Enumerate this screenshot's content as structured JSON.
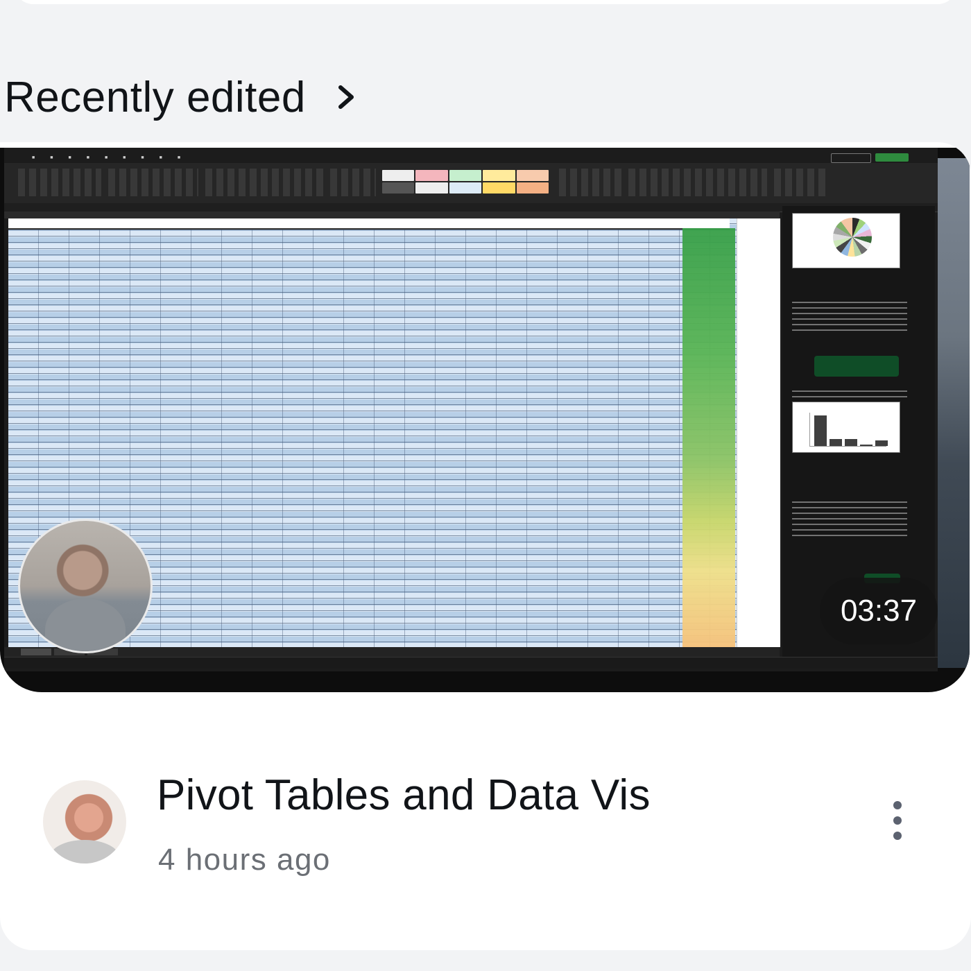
{
  "section": {
    "title": "Recently edited"
  },
  "video": {
    "duration": "03:37",
    "title": "Pivot Tables and Data Vis",
    "timestamp": "4 hours ago"
  }
}
